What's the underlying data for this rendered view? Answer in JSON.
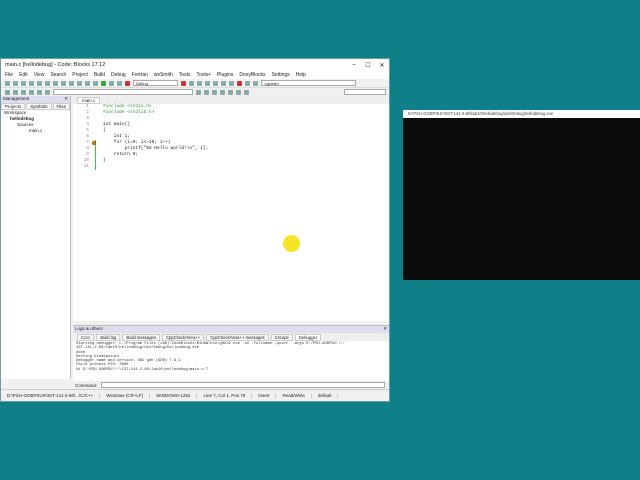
{
  "window": {
    "title": "main.c [hellodebug] - Code::Blocks 17.12",
    "min": "–",
    "max": "☐",
    "close": "✕"
  },
  "menu": [
    "File",
    "Edit",
    "View",
    "Search",
    "Project",
    "Build",
    "Debug",
    "Fortran",
    "wxSmith",
    "Tools",
    "Tools+",
    "Plugins",
    "DoxyBlocks",
    "Settings",
    "Help"
  ],
  "toolbar": {
    "build_target": "Debug",
    "scope": "<global>"
  },
  "management": {
    "title": "Management",
    "tabs": [
      "Projects",
      "Symbols",
      "Files"
    ],
    "tree": [
      "Workspace",
      "hellodebug",
      "Sources",
      "main.c"
    ]
  },
  "editor": {
    "tab": "main.c",
    "lines": [
      {
        "n": "1",
        "t": "#include <stdio.h>",
        "cls": "pp"
      },
      {
        "n": "2",
        "t": "#include <stdlib.h>",
        "cls": "pp"
      },
      {
        "n": "3",
        "t": "",
        "cls": ""
      },
      {
        "n": "4",
        "t": "int main()",
        "cls": ""
      },
      {
        "n": "5",
        "t": "{",
        "cls": ""
      },
      {
        "n": "6",
        "t": "    int i;",
        "cls": ""
      },
      {
        "n": "7",
        "t": "    for (i=0; i<=10; i++)",
        "cls": ""
      },
      {
        "n": "8",
        "t": "        printf(\"%d Hello world!\\n\", i);",
        "cls": ""
      },
      {
        "n": "9",
        "t": "    return 0;",
        "cls": ""
      },
      {
        "n": "10",
        "t": "}",
        "cls": ""
      },
      {
        "n": "11",
        "t": "",
        "cls": ""
      }
    ]
  },
  "logs": {
    "title": "Logs & others",
    "tabs": [
      "Cccc",
      "Build log",
      "Build messages",
      "CppCheck/Vera++",
      "CppCheck/Vera++ messages",
      "Cscope",
      "Debugger"
    ],
    "lines": [
      "Starting debugger: C:\\Program Files (x86)\\CodeBlocks\\MinGW\\bin\\gdb32.exe -nx -fullname -quiet  -args D:/PSU-GOBPSU!!!/",
      "IST-141-2-60/lab10/hellodebug/bin/Debug/hellodebug.exe",
      "done",
      "Setting breakpoints",
      "Debugger name and version: GNU gdb (GDB) 7.9.1",
      "Child process PID: 3080",
      "At D:\\PSU-GOBPSU!!!\\IST-141-2-60\\lab10\\hellodebug\\main.c:7"
    ],
    "command_label": "Command:"
  },
  "status": [
    "D:\\PSU-GOBPSU!!!\\IST-141-2-60\\...\\C/C++",
    "Windows (CR+LF)",
    "WINDOWS-1252",
    "Line 7, Col 1, Pos 78",
    "Insert",
    "Read/Write",
    "default"
  ],
  "console": {
    "title": "D:\\PSU-GOBPSU!!!\\IST-141-2-60\\lab10\\hellodebug\\bin\\Debug\\hellodebug.exe"
  }
}
